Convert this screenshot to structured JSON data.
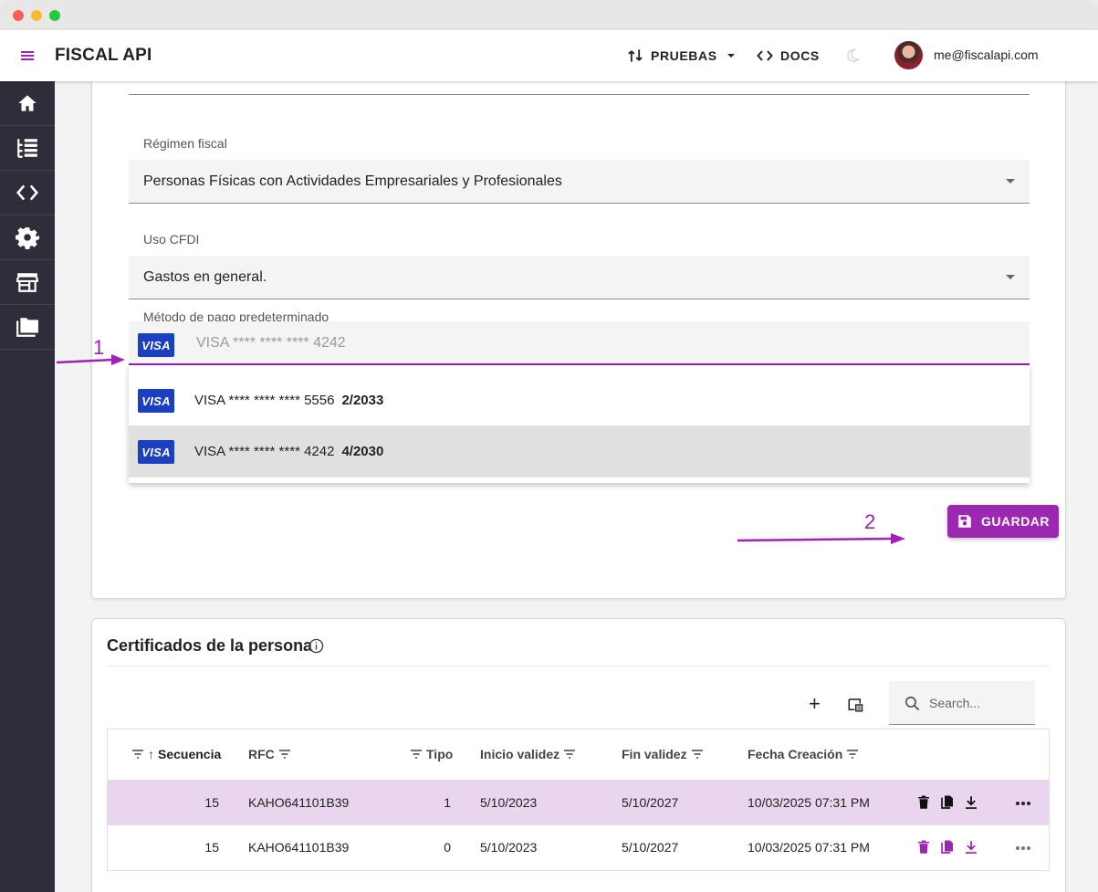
{
  "window": {
    "controls": [
      "close",
      "minimize",
      "maximize"
    ]
  },
  "appbar": {
    "brand": "FISCAL API",
    "env_label": "PRUEBAS",
    "docs_label": "DOCS",
    "user_email": "me@fiscalapi.com"
  },
  "sidebar": {
    "items": [
      {
        "icon": "home-icon"
      },
      {
        "icon": "list-tree-icon"
      },
      {
        "icon": "code-icon"
      },
      {
        "icon": "gear-icon"
      },
      {
        "icon": "store-icon"
      },
      {
        "icon": "folders-icon"
      }
    ]
  },
  "form": {
    "regimen": {
      "label": "Régimen fiscal",
      "value": "Personas Físicas con Actividades Empresariales y Profesionales"
    },
    "uso_cfdi": {
      "label": "Uso CFDI",
      "value": "Gastos en general."
    },
    "payment": {
      "label": "Método de pago predeterminado",
      "placeholder": "VISA  **** **** **** 4242",
      "brand_badge": "VISA",
      "options": [
        {
          "brand": "VISA",
          "text": "VISA **** **** **** 5556",
          "exp": "2/2033",
          "selected": false
        },
        {
          "brand": "VISA",
          "text": "VISA **** **** **** 4242",
          "exp": "4/2030",
          "selected": true
        }
      ]
    },
    "save_label": "GUARDAR"
  },
  "annotations": {
    "step1": "1",
    "step2": "2",
    "color": "#a020b8"
  },
  "certificates": {
    "title": "Certificados de la persona",
    "search_placeholder": "Search...",
    "columns": [
      "Secuencia",
      "RFC",
      "Tipo",
      "Inicio validez",
      "Fin validez",
      "Fecha Creación"
    ],
    "rows": [
      {
        "secuencia": "15",
        "rfc": "KAHO641101B39",
        "tipo": "1",
        "inicio": "5/10/2023",
        "fin": "5/10/2027",
        "creacion": "10/03/2025 07:31 PM"
      },
      {
        "secuencia": "15",
        "rfc": "KAHO641101B39",
        "tipo": "0",
        "inicio": "5/10/2023",
        "fin": "5/10/2027",
        "creacion": "10/03/2025 07:31 PM"
      }
    ]
  },
  "colors": {
    "accent": "#9c27b0",
    "sidebar": "#2e2e3a",
    "visa": "#1a3fc0",
    "row_highlight": "#ead5ef"
  }
}
